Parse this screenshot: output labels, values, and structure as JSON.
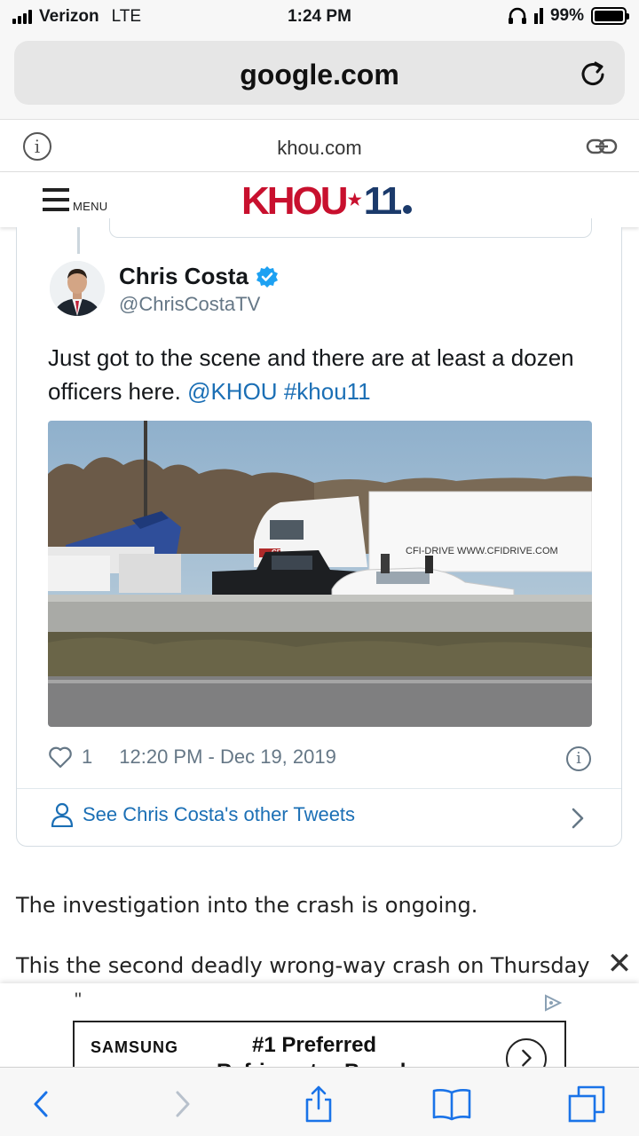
{
  "status_bar": {
    "carrier": "Verizon",
    "network": "LTE",
    "time": "1:24 PM",
    "battery": "99%",
    "battery_level": 0.99
  },
  "browser": {
    "url": "google.com",
    "site_domain": "khou.com"
  },
  "site_header": {
    "menu_label": "MENU",
    "logo_text": "KHOU",
    "logo_number": "11",
    "brand_red": "#c8102e",
    "brand_navy": "#1b3a6b"
  },
  "tweet": {
    "author_name": "Chris Costa",
    "handle": "@ChrisCostaTV",
    "text_plain": "Just got to the scene and there are at least a dozen officers here.",
    "mention": "@KHOU",
    "hashtag": "#khou11",
    "media_truck_sign": "CFI-DRIVE  WWW.CFIDRIVE.COM",
    "media_cab_sign": "CFI",
    "likes": "1",
    "timestamp": "12:20 PM - Dec 19, 2019",
    "other_tweets_label": "See Chris Costa's other Tweets",
    "link_color": "#1b6fb5"
  },
  "article": {
    "paragraph_1": "The investigation into the crash is ongoing.",
    "paragraph_2": "This the second deadly wrong-way crash on Thursday"
  },
  "ad": {
    "quote_mark": "\"",
    "brand": "SAMSUNG",
    "headline": "#1 Preferred",
    "headline_2": "Refrigerator Brand"
  },
  "toolbar": {
    "icons": [
      "back-icon",
      "forward-icon",
      "share-icon",
      "bookmarks-icon",
      "tabs-icon"
    ],
    "accent": "#1a73e8"
  }
}
